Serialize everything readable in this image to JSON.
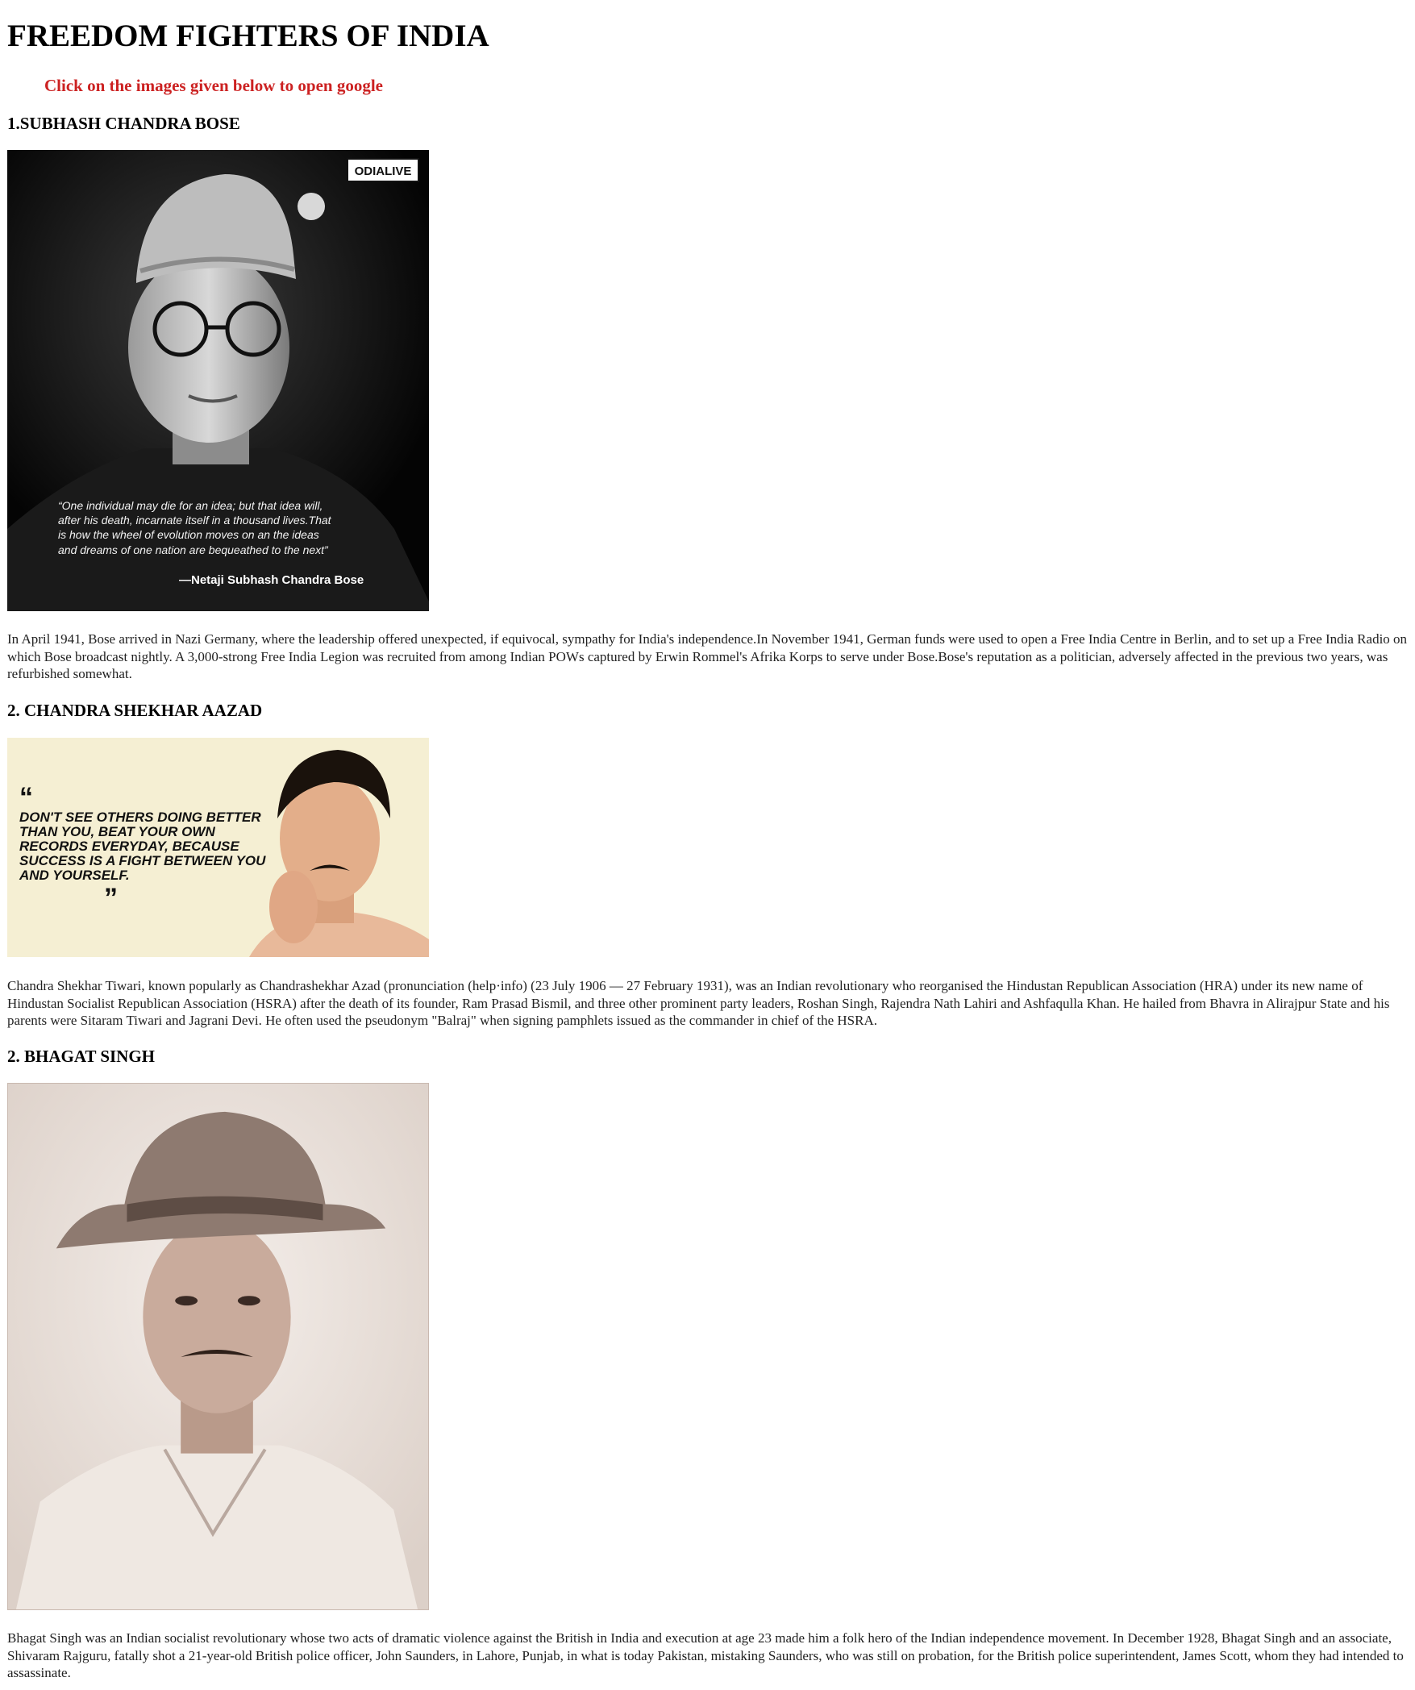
{
  "page": {
    "title": "FREEDOM FIGHTERS OF INDIA",
    "instruction": "Click on the images given below to open google"
  },
  "sections": [
    {
      "heading": "1.SUBHASH CHANDRA BOSE",
      "image": {
        "logo_text": "ODIALIVE",
        "quote_lines": [
          "“One individual may die for an idea; but that idea will,",
          "after his death, incarnate itself in a thousand lives.That",
          "is how the wheel of evolution moves on an the ideas",
          "and dreams of one nation are bequeathed to the next”"
        ],
        "attribution": "—Netaji Subhash Chandra Bose"
      },
      "text": "In April 1941, Bose arrived in Nazi Germany, where the leadership offered unexpected, if equivocal, sympathy for India's independence.In November 1941, German funds were used to open a Free India Centre in Berlin, and to set up a Free India Radio on which Bose broadcast nightly. A 3,000-strong Free India Legion was recruited from among Indian POWs captured by Erwin Rommel's Afrika Korps to serve under Bose.Bose's reputation as a politician, adversely affected in the previous two years, was refurbished somewhat."
    },
    {
      "heading": "2. CHANDRA SHEKHAR AAZAD",
      "image": {
        "quote_lines": [
          "DON'T SEE OTHERS DOING BETTER",
          "THAN YOU, BEAT YOUR OWN",
          "RECORDS EVERYDAY, BECAUSE",
          "SUCCESS IS A FIGHT BETWEEN YOU",
          "AND YOURSELF."
        ]
      },
      "text": "Chandra Shekhar Tiwari, known popularly as Chandrashekhar Azad (pronunciation (help·info) (23 July 1906 — 27 February 1931), was an Indian revolutionary who reorganised the Hindustan Republican Association (HRA) under its new name of Hindustan Socialist Republican Association (HSRA) after the death of its founder, Ram Prasad Bismil, and three other prominent party leaders, Roshan Singh, Rajendra Nath Lahiri and Ashfaqulla Khan. He hailed from Bhavra in Alirajpur State and his parents were Sitaram Tiwari and Jagrani Devi. He often used the pseudonym \"Balraj\" when signing pamphlets issued as the commander in chief of the HSRA."
    },
    {
      "heading": "2. BHAGAT SINGH",
      "text": "Bhagat Singh was an Indian socialist revolutionary whose two acts of dramatic violence against the British in India and execution at age 23 made him a folk hero of the Indian independence movement. In December 1928, Bhagat Singh and an associate, Shivaram Rajguru, fatally shot a 21-year-old British police officer, John Saunders, in Lahore, Punjab, in what is today Pakistan, mistaking Saunders, who was still on probation, for the British police superintendent, James Scott, whom they had intended to assassinate."
    }
  ]
}
